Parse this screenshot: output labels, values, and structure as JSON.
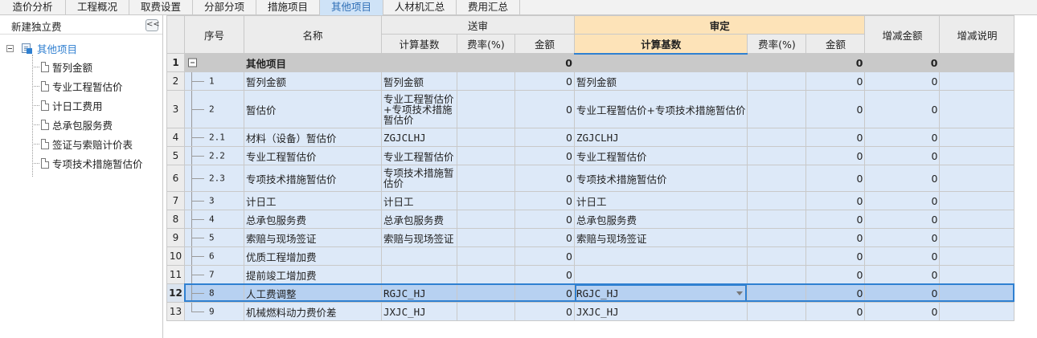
{
  "tabs": [
    "造价分析",
    "工程概况",
    "取费设置",
    "分部分项",
    "措施项目",
    "其他项目",
    "人材机汇总",
    "费用汇总"
  ],
  "active_tab": "其他项目",
  "sidebar": {
    "title": "新建独立费",
    "collapse_glyph": "<<",
    "root": "其他项目",
    "items": [
      "暂列金额",
      "专业工程暂估价",
      "计日工费用",
      "总承包服务费",
      "签证与索赔计价表",
      "专项技术措施暂估价"
    ]
  },
  "grid": {
    "headers": {
      "seq": "序号",
      "name": "名称",
      "songshen": "送审",
      "shending": "审定",
      "base": "计算基数",
      "rate": "费率(%)",
      "amount": "金额",
      "diff_amount": "增减金额",
      "diff_note": "增减说明"
    },
    "rows": [
      {
        "rn": "1",
        "seq": "",
        "name": "其他项目",
        "s_base": "",
        "s_rate": "",
        "s_amt": "0",
        "d_base": "",
        "d_rate": "",
        "d_amt": "0",
        "diff": "0",
        "note": ""
      },
      {
        "rn": "2",
        "seq": "1",
        "name": "暂列金额",
        "s_base": "暂列金额",
        "s_rate": "",
        "s_amt": "0",
        "d_base": "暂列金额",
        "d_rate": "",
        "d_amt": "0",
        "diff": "0",
        "note": ""
      },
      {
        "rn": "3",
        "seq": "2",
        "name": "暂估价",
        "s_base": "专业工程暂估价+专项技术措施暂估价",
        "s_rate": "",
        "s_amt": "0",
        "d_base": "专业工程暂估价+专项技术措施暂估价",
        "d_rate": "",
        "d_amt": "0",
        "diff": "0",
        "note": ""
      },
      {
        "rn": "4",
        "seq": "2.1",
        "name": "材料（设备）暂估价",
        "s_base": "ZGJCLHJ",
        "s_rate": "",
        "s_amt": "0",
        "d_base": "ZGJCLHJ",
        "d_rate": "",
        "d_amt": "0",
        "diff": "0",
        "note": ""
      },
      {
        "rn": "5",
        "seq": "2.2",
        "name": "专业工程暂估价",
        "s_base": "专业工程暂估价",
        "s_rate": "",
        "s_amt": "0",
        "d_base": "专业工程暂估价",
        "d_rate": "",
        "d_amt": "0",
        "diff": "0",
        "note": ""
      },
      {
        "rn": "6",
        "seq": "2.3",
        "name": "专项技术措施暂估价",
        "s_base": "专项技术措施暂估价",
        "s_rate": "",
        "s_amt": "0",
        "d_base": "专项技术措施暂估价",
        "d_rate": "",
        "d_amt": "0",
        "diff": "0",
        "note": ""
      },
      {
        "rn": "7",
        "seq": "3",
        "name": "计日工",
        "s_base": "计日工",
        "s_rate": "",
        "s_amt": "0",
        "d_base": "计日工",
        "d_rate": "",
        "d_amt": "0",
        "diff": "0",
        "note": ""
      },
      {
        "rn": "8",
        "seq": "4",
        "name": "总承包服务费",
        "s_base": "总承包服务费",
        "s_rate": "",
        "s_amt": "0",
        "d_base": "总承包服务费",
        "d_rate": "",
        "d_amt": "0",
        "diff": "0",
        "note": ""
      },
      {
        "rn": "9",
        "seq": "5",
        "name": "索赔与现场签证",
        "s_base": "索赔与现场签证",
        "s_rate": "",
        "s_amt": "0",
        "d_base": "索赔与现场签证",
        "d_rate": "",
        "d_amt": "0",
        "diff": "0",
        "note": ""
      },
      {
        "rn": "10",
        "seq": "6",
        "name": "优质工程增加费",
        "s_base": "",
        "s_rate": "",
        "s_amt": "0",
        "d_base": "",
        "d_rate": "",
        "d_amt": "0",
        "diff": "0",
        "note": ""
      },
      {
        "rn": "11",
        "seq": "7",
        "name": "提前竣工增加费",
        "s_base": "",
        "s_rate": "",
        "s_amt": "0",
        "d_base": "",
        "d_rate": "",
        "d_amt": "0",
        "diff": "0",
        "note": ""
      },
      {
        "rn": "12",
        "seq": "8",
        "name": "人工费调整",
        "s_base": "RGJC_HJ",
        "s_rate": "",
        "s_amt": "0",
        "d_base": "RGJC_HJ",
        "d_rate": "",
        "d_amt": "0",
        "diff": "0",
        "note": ""
      },
      {
        "rn": "13",
        "seq": "9",
        "name": "机械燃料动力费价差",
        "s_base": "JXJC_HJ",
        "s_rate": "",
        "s_amt": "0",
        "d_base": "JXJC_HJ",
        "d_rate": "",
        "d_amt": "0",
        "diff": "0",
        "note": ""
      }
    ]
  },
  "colors": {
    "active_tab_bg": "#cfe3f7",
    "row_bg": "#dde9f8",
    "selected_row_bg": "#b7d1f1",
    "shending_header_bg": "#fde3b8",
    "accent": "#2f80d1"
  }
}
